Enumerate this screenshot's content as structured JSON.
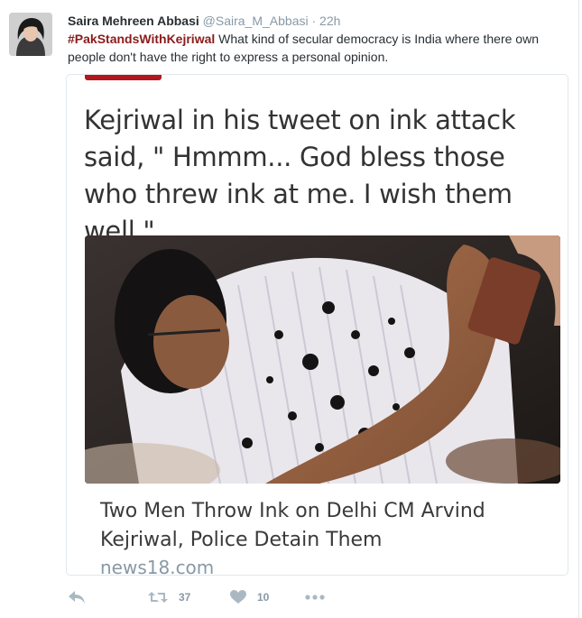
{
  "tweet": {
    "fullname": "Saira Mehreen Abbasi",
    "username": "@Saira_M_Abbasi",
    "separator": "·",
    "time": "22h",
    "hashtag": "#PakStandsWithKejriwal",
    "text": " What kind of secular democracy is India where there own people don't have the right to express a personal opinion."
  },
  "card": {
    "headline": "Kejriwal in his tweet on ink attack said, \" Hmmm... God bless those who threw ink at me. I wish them well.\"",
    "title": "Two Men Throw Ink on Delhi CM Arvind Kejriwal, Police Detain Them",
    "domain": "news18.com"
  },
  "actions": {
    "reply_icon": "reply-icon",
    "retweet_icon": "retweet-icon",
    "retweet_count": "37",
    "like_icon": "heart-icon",
    "like_count": "10",
    "more_icon": "more-icon"
  },
  "colors": {
    "hashtag": "#8b1b1b",
    "meta": "#8899a6",
    "action_icon": "#aab8c2",
    "card_accent": "#b3171e"
  }
}
